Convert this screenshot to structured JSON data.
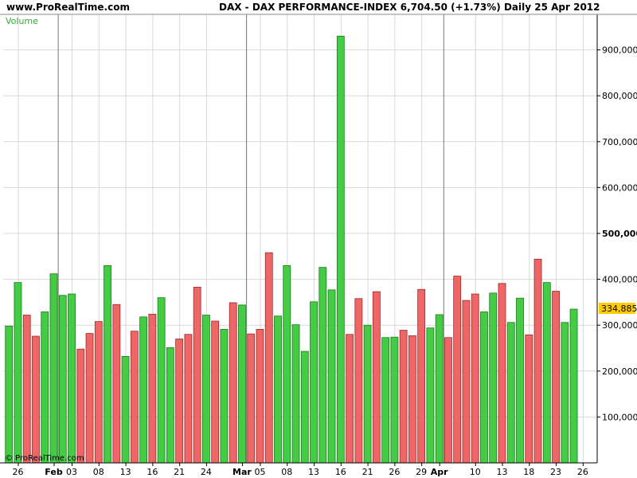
{
  "header": {
    "site": "www.ProRealTime.com",
    "title": "DAX - DAX PERFORMANCE-INDEX    6,704.50 (+1.73%)    Daily  25 Apr 2012"
  },
  "watermark": "© ProRealTime.com",
  "last_value_label": "334,885",
  "colors": {
    "up": "#44cc44",
    "down": "#ee6666",
    "grid": "#d8d8d8",
    "bg": "#ffffff",
    "indicator_label": "#33aa33",
    "last_value_bg": "#ffcc00"
  },
  "chart_data": {
    "type": "bar",
    "indicator": "Volume",
    "ylim": [
      0,
      1000000
    ],
    "y_ticks": [
      {
        "value": 100000,
        "label": "100,000"
      },
      {
        "value": 200000,
        "label": "200,000"
      },
      {
        "value": 300000,
        "label": "300,000"
      },
      {
        "value": 400000,
        "label": "400,000"
      },
      {
        "value": 500000,
        "label": "500,000"
      },
      {
        "value": 600000,
        "label": "600,000"
      },
      {
        "value": 700000,
        "label": "700,000"
      },
      {
        "value": 800000,
        "label": "800,000"
      },
      {
        "value": 900000,
        "label": "900,000"
      }
    ],
    "x_ticks": [
      {
        "index": 1,
        "label": "26"
      },
      {
        "index": 5,
        "label": "Feb",
        "month": true
      },
      {
        "index": 7,
        "label": "03"
      },
      {
        "index": 10,
        "label": "08"
      },
      {
        "index": 13,
        "label": "13"
      },
      {
        "index": 16,
        "label": "16"
      },
      {
        "index": 19,
        "label": "21"
      },
      {
        "index": 22,
        "label": "24"
      },
      {
        "index": 26,
        "label": "Mar",
        "month": true
      },
      {
        "index": 28,
        "label": "05"
      },
      {
        "index": 31,
        "label": "08"
      },
      {
        "index": 34,
        "label": "13"
      },
      {
        "index": 37,
        "label": "16"
      },
      {
        "index": 40,
        "label": "21"
      },
      {
        "index": 43,
        "label": "26"
      },
      {
        "index": 46,
        "label": "29"
      },
      {
        "index": 48,
        "label": "Apr",
        "month": true
      },
      {
        "index": 52,
        "label": "10"
      },
      {
        "index": 55,
        "label": "13"
      },
      {
        "index": 58,
        "label": "18"
      },
      {
        "index": 61,
        "label": "23"
      },
      {
        "index": 64,
        "label": "26"
      }
    ],
    "month_separators": [
      5.5,
      26.5,
      48.5
    ],
    "bars": [
      {
        "v": 298000,
        "d": "up"
      },
      {
        "v": 393000,
        "d": "up"
      },
      {
        "v": 322000,
        "d": "down"
      },
      {
        "v": 276000,
        "d": "down"
      },
      {
        "v": 329000,
        "d": "up"
      },
      {
        "v": 412000,
        "d": "up"
      },
      {
        "v": 365000,
        "d": "up"
      },
      {
        "v": 368000,
        "d": "up"
      },
      {
        "v": 248000,
        "d": "down"
      },
      {
        "v": 282000,
        "d": "down"
      },
      {
        "v": 308000,
        "d": "down"
      },
      {
        "v": 430000,
        "d": "up"
      },
      {
        "v": 345000,
        "d": "down"
      },
      {
        "v": 232000,
        "d": "up"
      },
      {
        "v": 287000,
        "d": "down"
      },
      {
        "v": 318000,
        "d": "up"
      },
      {
        "v": 324000,
        "d": "down"
      },
      {
        "v": 360000,
        "d": "up"
      },
      {
        "v": 251000,
        "d": "up"
      },
      {
        "v": 270000,
        "d": "down"
      },
      {
        "v": 280000,
        "d": "down"
      },
      {
        "v": 383000,
        "d": "down"
      },
      {
        "v": 322000,
        "d": "up"
      },
      {
        "v": 309000,
        "d": "down"
      },
      {
        "v": 291000,
        "d": "up"
      },
      {
        "v": 349000,
        "d": "down"
      },
      {
        "v": 344000,
        "d": "up"
      },
      {
        "v": 281000,
        "d": "down"
      },
      {
        "v": 291000,
        "d": "down"
      },
      {
        "v": 458000,
        "d": "down"
      },
      {
        "v": 320000,
        "d": "up"
      },
      {
        "v": 430000,
        "d": "up"
      },
      {
        "v": 301000,
        "d": "up"
      },
      {
        "v": 243000,
        "d": "up"
      },
      {
        "v": 351000,
        "d": "up"
      },
      {
        "v": 426000,
        "d": "up"
      },
      {
        "v": 377000,
        "d": "up"
      },
      {
        "v": 930000,
        "d": "up"
      },
      {
        "v": 280000,
        "d": "down"
      },
      {
        "v": 358000,
        "d": "down"
      },
      {
        "v": 300000,
        "d": "up"
      },
      {
        "v": 373000,
        "d": "down"
      },
      {
        "v": 273000,
        "d": "up"
      },
      {
        "v": 274000,
        "d": "up"
      },
      {
        "v": 289000,
        "d": "down"
      },
      {
        "v": 277000,
        "d": "down"
      },
      {
        "v": 378000,
        "d": "down"
      },
      {
        "v": 294000,
        "d": "up"
      },
      {
        "v": 323000,
        "d": "up"
      },
      {
        "v": 273000,
        "d": "down"
      },
      {
        "v": 407000,
        "d": "down"
      },
      {
        "v": 354000,
        "d": "down"
      },
      {
        "v": 368000,
        "d": "down"
      },
      {
        "v": 329000,
        "d": "up"
      },
      {
        "v": 370000,
        "d": "up"
      },
      {
        "v": 391000,
        "d": "down"
      },
      {
        "v": 306000,
        "d": "up"
      },
      {
        "v": 359000,
        "d": "up"
      },
      {
        "v": 279000,
        "d": "down"
      },
      {
        "v": 444000,
        "d": "down"
      },
      {
        "v": 393000,
        "d": "up"
      },
      {
        "v": 374000,
        "d": "down"
      },
      {
        "v": 306000,
        "d": "up"
      },
      {
        "v": 335000,
        "d": "up"
      }
    ]
  }
}
